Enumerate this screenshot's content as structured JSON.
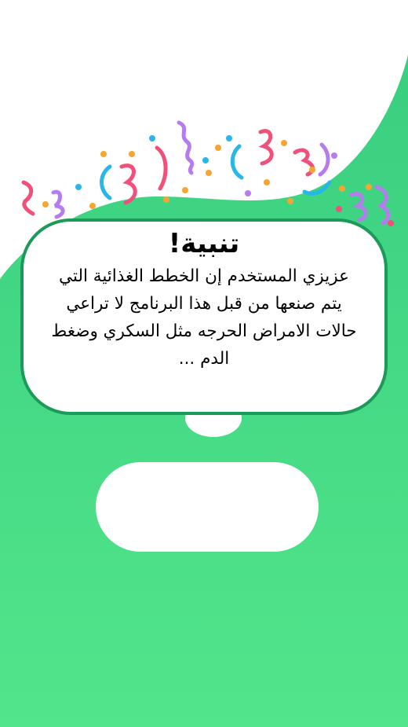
{
  "colors": {
    "green_light": "#52e58b",
    "green_main": "#3fd684",
    "green_border": "#1c9a5a",
    "confetti_pink": "#f0507a",
    "confetti_blue": "#29b6e8",
    "confetti_purple": "#b77bf0",
    "confetti_orange": "#f7a531"
  },
  "warning": {
    "title": "تنبية!",
    "body": "عزيزي المستخدم إن الخطط الغذائية التي يتم صنعها من قبل هذا البرنامج لا تراعي حالات الامراض الحرجه مثل السكري وضغط الدم ..."
  },
  "action": {
    "label": ""
  }
}
